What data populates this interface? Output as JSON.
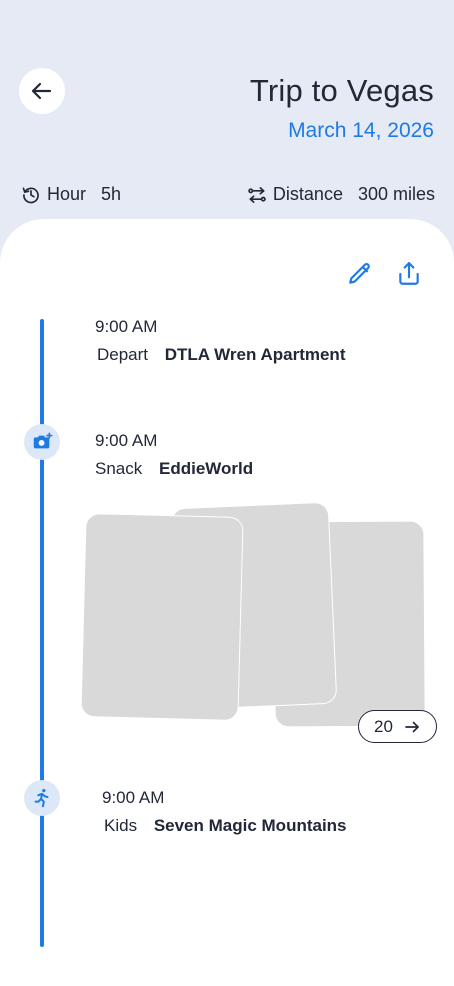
{
  "header": {
    "title": "Trip to Vegas",
    "date": "March 14, 2026",
    "back_icon": "arrow-left-icon"
  },
  "stats": {
    "hour_label": "Hour",
    "hour_value": "5h",
    "distance_label": "Distance",
    "distance_value": "300 miles"
  },
  "actions": {
    "edit_icon": "pencil-icon",
    "share_icon": "share-icon"
  },
  "timeline": {
    "entries": [
      {
        "time": "9:00 AM",
        "category": "Depart",
        "place": "DTLA Wren Apartment",
        "badge_icon": ""
      },
      {
        "time": "9:00 AM",
        "category": "Snack",
        "place": "EddieWorld",
        "badge_icon": "camera-add-icon"
      },
      {
        "time": "9:00 AM",
        "category": "Kids",
        "place": "Seven Magic Mountains",
        "badge_icon": "running-person-icon"
      }
    ]
  },
  "photos": {
    "count": "20"
  },
  "colors": {
    "accent": "#1f7ae6",
    "background": "#e6eaf4",
    "text": "#222838",
    "placeholder": "#d9d9d9"
  }
}
